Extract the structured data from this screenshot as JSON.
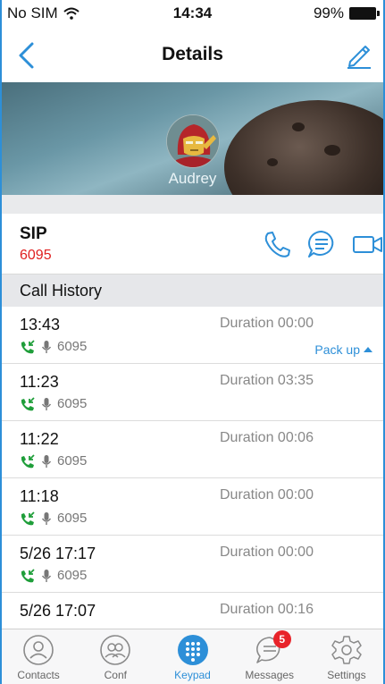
{
  "status_bar": {
    "carrier": "No SIM",
    "time": "14:34",
    "battery": "99%"
  },
  "nav": {
    "title": "Details"
  },
  "contact": {
    "name": "Audrey"
  },
  "sip": {
    "label": "SIP",
    "number": "6095"
  },
  "history": {
    "header": "Call History",
    "items": [
      {
        "time": "13:43",
        "number": "6095",
        "duration": "Duration 00:00",
        "packup": "Pack up"
      },
      {
        "time": "11:23",
        "number": "6095",
        "duration": "Duration 03:35"
      },
      {
        "time": "11:22",
        "number": "6095",
        "duration": "Duration 00:06"
      },
      {
        "time": "11:18",
        "number": "6095",
        "duration": "Duration 00:00"
      },
      {
        "time": "5/26 17:17",
        "number": "6095",
        "duration": "Duration 00:00"
      },
      {
        "time": "5/26 17:07",
        "number": "",
        "duration": "Duration 00:16"
      }
    ]
  },
  "tabs": [
    {
      "label": "Contacts",
      "icon": "contacts-icon"
    },
    {
      "label": "Conf",
      "icon": "conference-icon"
    },
    {
      "label": "Keypad",
      "icon": "keypad-icon",
      "active": true
    },
    {
      "label": "Messages",
      "icon": "messages-icon",
      "badge": "5"
    },
    {
      "label": "Settings",
      "icon": "settings-icon"
    }
  ],
  "colors": {
    "accent": "#2d8fd8",
    "sip_number": "#e02020",
    "call_green": "#1f9e3a",
    "badge": "#e8232a"
  }
}
